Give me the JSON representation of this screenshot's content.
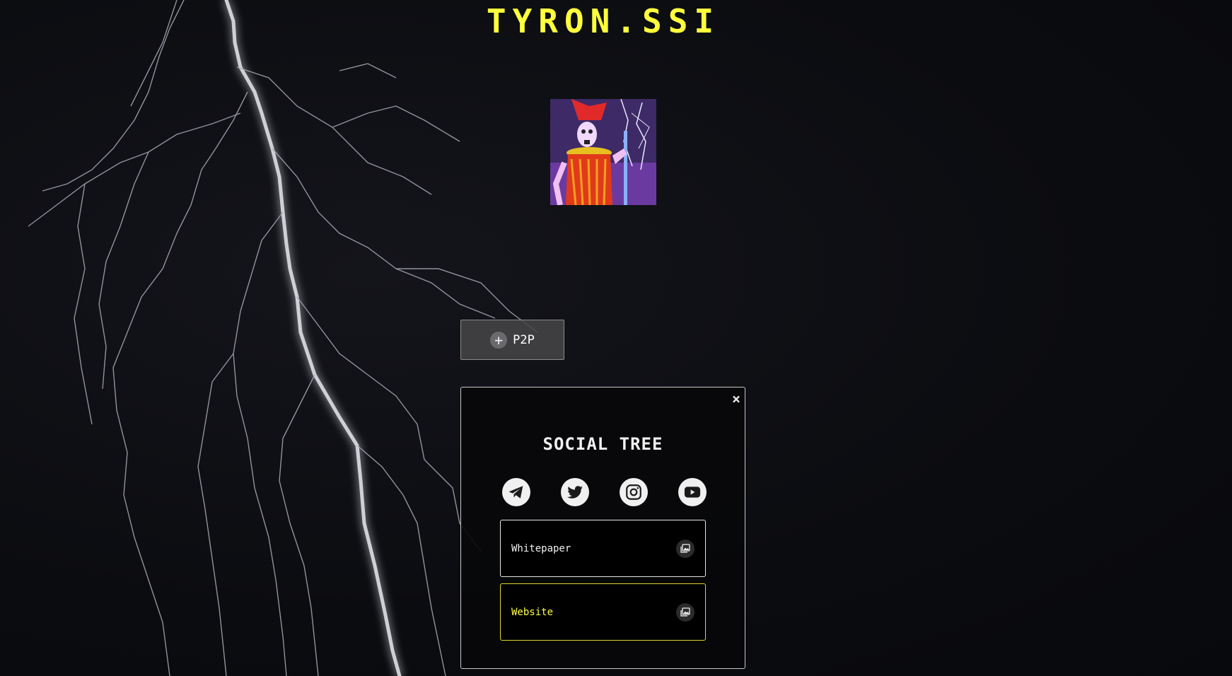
{
  "header": {
    "title": "TYRON.SSI"
  },
  "avatar": {
    "alt": "skeleton character avatar"
  },
  "p2p_button": {
    "label": "P2P",
    "icon": "plus-circle-icon"
  },
  "social_tree": {
    "title": "SOCIAL TREE",
    "close_label": "×",
    "social_icons": [
      "telegram-icon",
      "twitter-icon",
      "instagram-icon",
      "youtube-icon"
    ],
    "links": [
      {
        "label": "Whitepaper",
        "icon": "image-stack-icon"
      },
      {
        "label": "Website",
        "icon": "image-stack-icon"
      }
    ]
  },
  "colors": {
    "background": "#0b0c10",
    "accent": "#ffff3c",
    "panel_border": "#c8c8c8",
    "card_yellow_border": "#e0d62a"
  }
}
